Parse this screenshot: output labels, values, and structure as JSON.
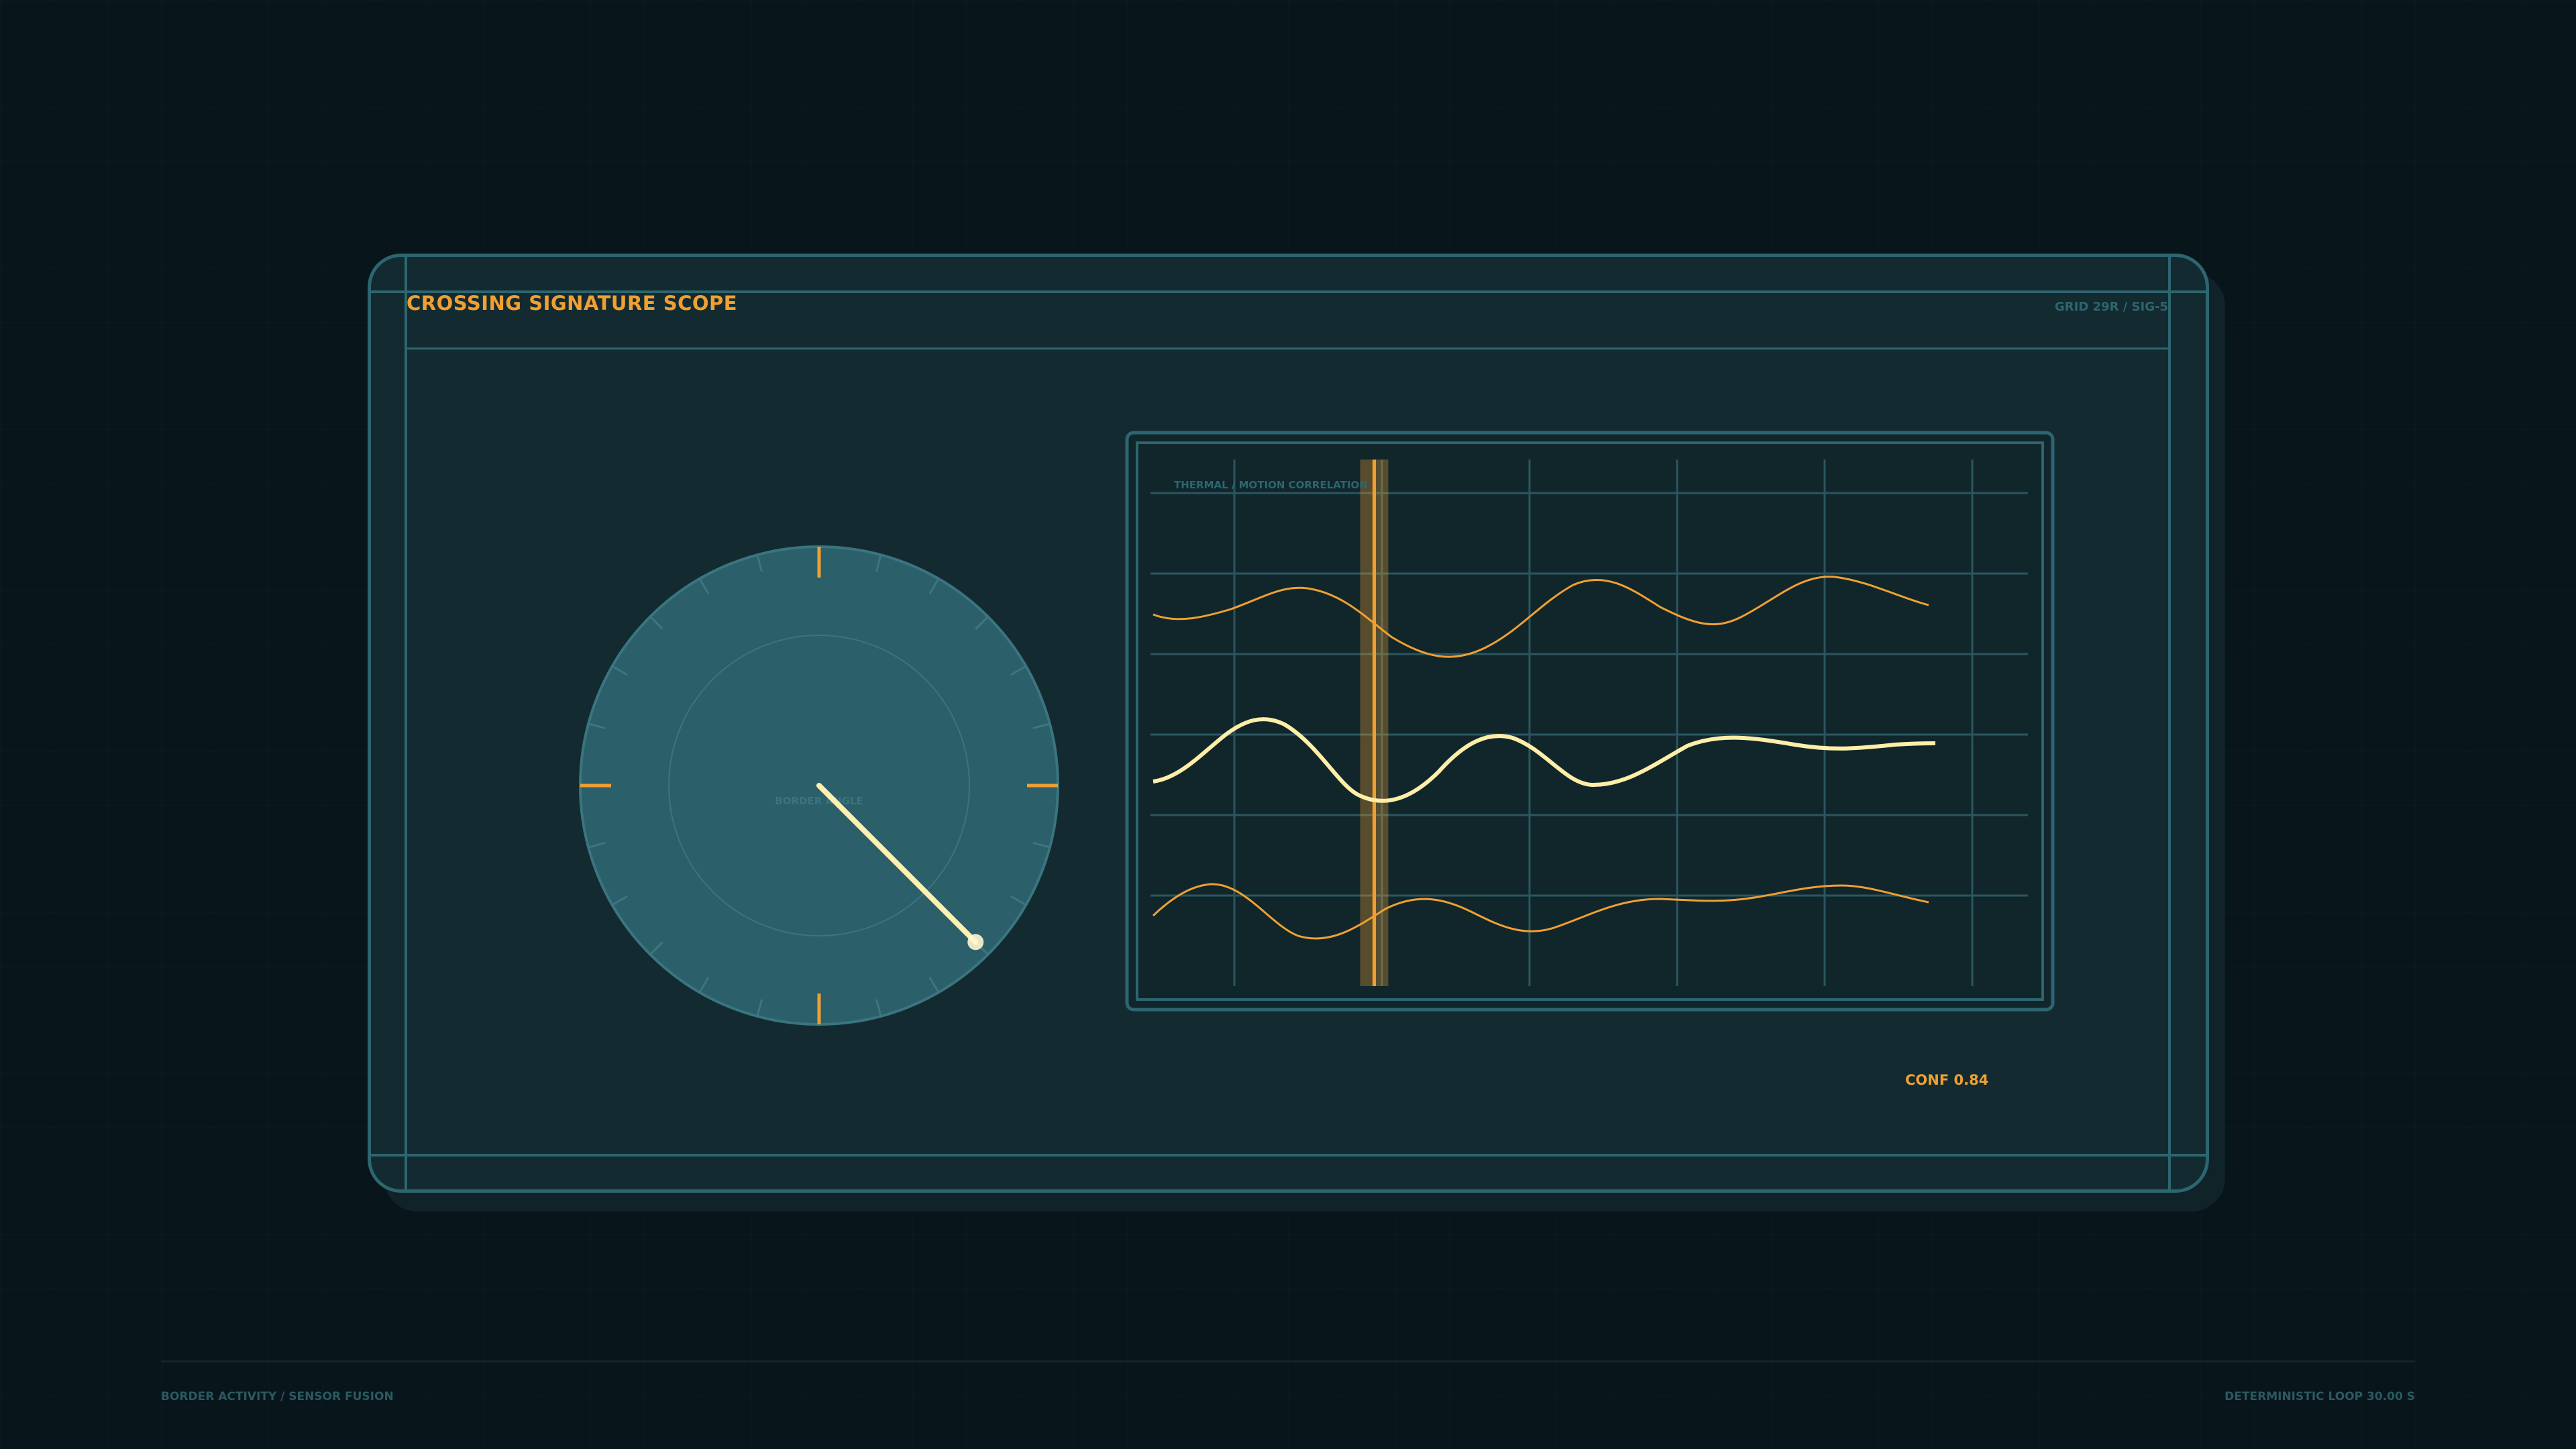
{
  "panel": {
    "title": "CROSSING SIGNATURE SCOPE",
    "grid_ref": "GRID 29R / SIG-5",
    "confidence": "CONF 0.84"
  },
  "dial": {
    "label": "BORDER ANGLE",
    "needle_angle_deg": 135,
    "colors": {
      "face": "#2b5f69",
      "needle": "#fff0b0",
      "tick_major": "#f0a032",
      "tick_minor": "#3d7680"
    }
  },
  "scope": {
    "chart_title": "THERMAL / MOTION CORRELATION",
    "marker_position": 0.255,
    "trace_count": 3,
    "colors": {
      "trace_primary": "#ffeea8",
      "trace_secondary": "#f0a032",
      "grid": "#2b5660",
      "marker": "#f0a032"
    }
  },
  "footer": {
    "left": "BORDER ACTIVITY / SENSOR FUSION",
    "right": "DETERMINISTIC LOOP 30.00 S"
  }
}
